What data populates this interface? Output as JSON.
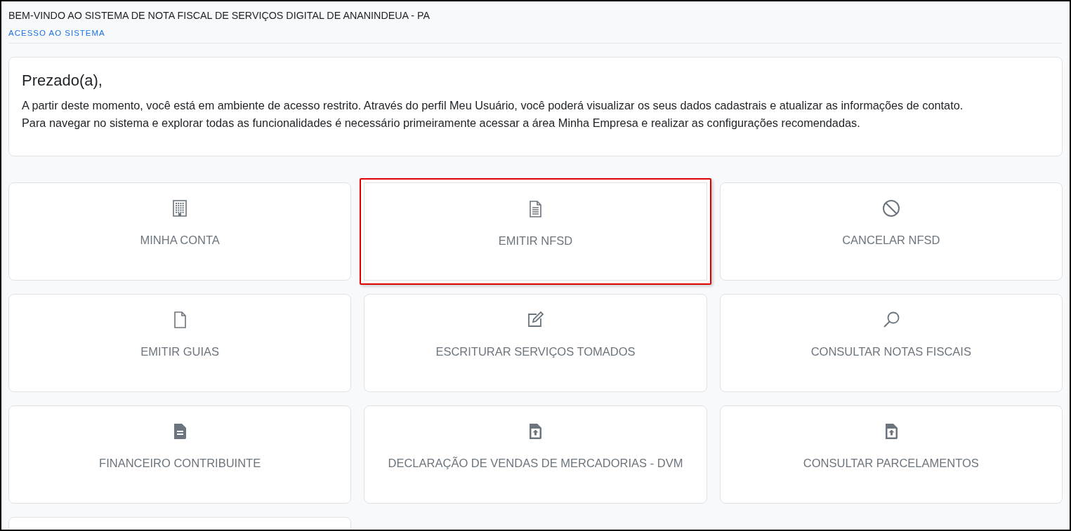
{
  "header": {
    "title": "BEM-VINDO AO SISTEMA DE NOTA FISCAL DE SERVIÇOS DIGITAL DE ANANINDEUA - PA",
    "breadcrumb": "ACESSO AO SISTEMA"
  },
  "notice": {
    "greeting": "Prezado(a),",
    "paragraphs": [
      "A partir deste momento, você está em ambiente de acesso restrito. Através do perfil Meu Usuário, você poderá visualizar os seus dados cadastrais e atualizar as informações de contato.",
      "Para navegar no sistema e explorar todas as funcionalidades é necessário primeiramente acessar a área Minha Empresa e realizar as configurações recomendadas."
    ]
  },
  "menu_cards": [
    {
      "label": "MINHA CONTA",
      "highlighted": false
    },
    {
      "label": "EMITIR NFSD",
      "highlighted": true
    },
    {
      "label": "CANCELAR NFSD",
      "highlighted": false
    },
    {
      "label": "EMITIR GUIAS",
      "highlighted": false
    },
    {
      "label": "ESCRITURAR SERVIÇOS TOMADOS",
      "highlighted": false
    },
    {
      "label": "CONSULTAR NOTAS FISCAIS",
      "highlighted": false
    },
    {
      "label": "FINANCEIRO CONTRIBUINTE",
      "highlighted": false
    },
    {
      "label": "DECLARAÇÃO DE VENDAS DE MERCADORIAS - DVM",
      "highlighted": false
    },
    {
      "label": "CONSULTAR PARCELAMENTOS",
      "highlighted": false
    }
  ]
}
